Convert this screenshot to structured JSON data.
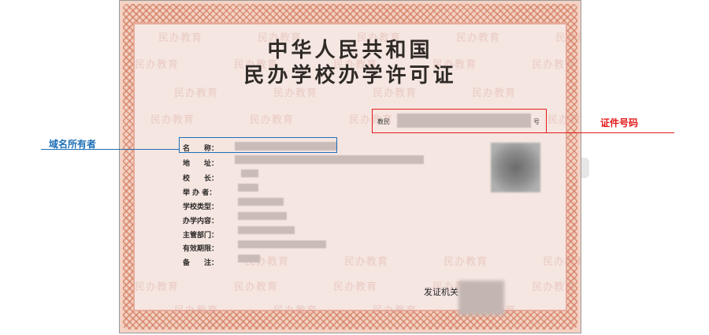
{
  "certificate": {
    "title_line1": "中华人民共和国",
    "title_line2": "民办学校办学许可证",
    "cert_no_prefix": "教民",
    "cert_no_suffix": "号",
    "watermark_text": "民办教育",
    "fields": [
      {
        "label": "名　　称："
      },
      {
        "label": "地　　址："
      },
      {
        "label": "校　　长："
      },
      {
        "label": "举 办 者："
      },
      {
        "label": "学校类型："
      },
      {
        "label": "办学内容："
      },
      {
        "label": "主管部门："
      },
      {
        "label": "有效期限："
      },
      {
        "label": "备　　注："
      }
    ],
    "issuer_label": "发证机关"
  },
  "annotations": {
    "domain_owner_label": "域名所有者",
    "cert_number_label": "证件号码"
  },
  "colors": {
    "domain_owner": "#1f6fb8",
    "cert_number": "#e31b1b",
    "border": "#d98b73",
    "paper": "#f5e6e1"
  }
}
